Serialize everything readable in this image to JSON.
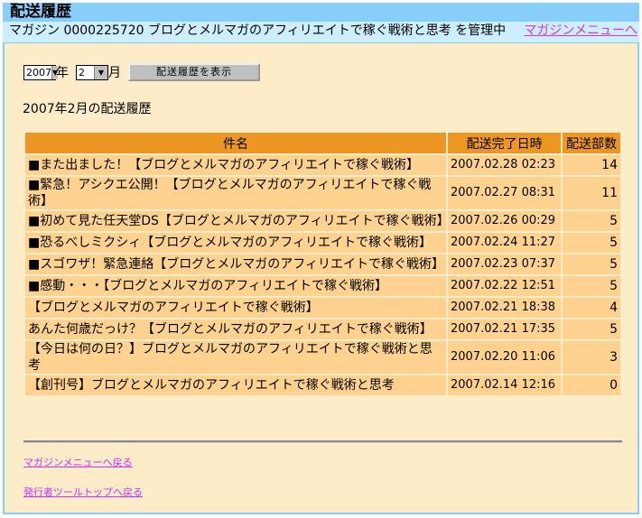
{
  "header": {
    "title": "配送履歴",
    "magazine_info": "マガジン 0000225720 ブログとメルマガのアフィリエイトで稼ぐ戦術と思考 を管理中",
    "menu_link": "マガジンメニューへ"
  },
  "controls": {
    "year": "2007",
    "year_suffix": "年",
    "month": "2",
    "month_suffix": "月",
    "show_button": "配送履歴を表示"
  },
  "heading": "2007年2月の配送履歴",
  "table": {
    "columns": [
      "件名",
      "配送完了日時",
      "配送部数"
    ],
    "rows": [
      {
        "subject": "■また出ました！【ブログとメルマガのアフィリエイトで稼ぐ戦術】",
        "date": "2007.02.28 02:23",
        "count": "14"
      },
      {
        "subject": "■緊急！アシクエ公開！【ブログとメルマガのアフィリエイトで稼ぐ戦術】",
        "date": "2007.02.27 08:31",
        "count": "11"
      },
      {
        "subject": "■初めて見た任天堂DS【ブログとメルマガのアフィリエイトで稼ぐ戦術】",
        "date": "2007.02.26 00:29",
        "count": "5"
      },
      {
        "subject": "■恐るべしミクシィ【ブログとメルマガのアフィリエイトで稼ぐ戦術】",
        "date": "2007.02.24 11:27",
        "count": "5"
      },
      {
        "subject": "■スゴワザ！緊急連絡【ブログとメルマガのアフィリエイトで稼ぐ戦術】",
        "date": "2007.02.23 07:37",
        "count": "5"
      },
      {
        "subject": "■感動・・・【ブログとメルマガのアフィリエイトで稼ぐ戦術】",
        "date": "2007.02.22 12:51",
        "count": "5"
      },
      {
        "subject": "【ブログとメルマガのアフィリエイトで稼ぐ戦術】",
        "date": "2007.02.21 18:38",
        "count": "4"
      },
      {
        "subject": "あんた何歳だっけ？【ブログとメルマガのアフィリエイトで稼ぐ戦術】",
        "date": "2007.02.21 17:35",
        "count": "5"
      },
      {
        "subject": "【今日は何の日？】ブログとメルマガのアフィリエイトで稼ぐ戦術と思考",
        "date": "2007.02.20 11:06",
        "count": "3"
      },
      {
        "subject": "【創刊号】ブログとメルマガのアフィリエイトで稼ぐ戦術と思考",
        "date": "2007.02.14 12:16",
        "count": "0"
      }
    ]
  },
  "footer": {
    "back_magazine": "マガジンメニューへ戻る",
    "back_tools": "発行者ツールトップへ戻る"
  }
}
